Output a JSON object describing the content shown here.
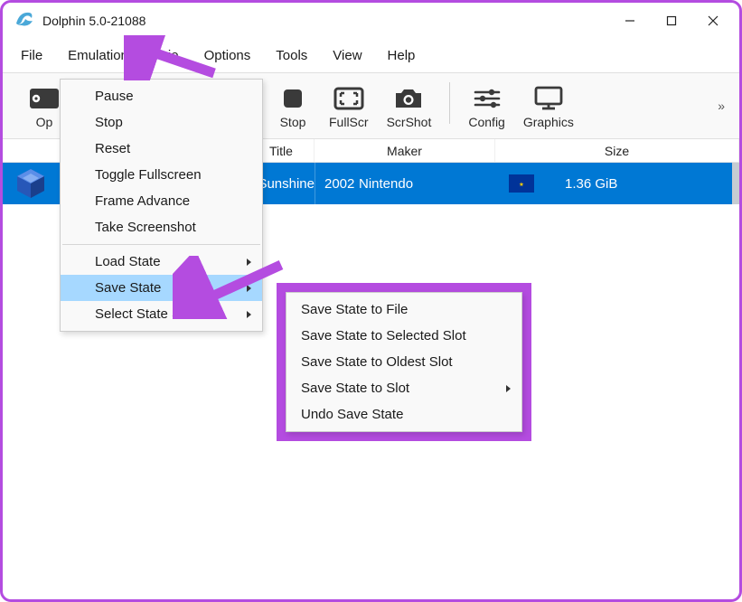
{
  "window": {
    "title": "Dolphin 5.0-21088"
  },
  "menubar": {
    "file": "File",
    "emulation": "Emulation",
    "movie_partial": "ie",
    "options": "Options",
    "tools": "Tools",
    "view": "View",
    "help": "Help"
  },
  "toolbar": {
    "open": "Op",
    "stop": "Stop",
    "fullscr": "FullScr",
    "scrshot": "ScrShot",
    "config": "Config",
    "graphics": "Graphics"
  },
  "columns": {
    "title": "Title",
    "maker": "Maker",
    "size": "Size"
  },
  "game": {
    "title_fragment": "ario Sunshine",
    "year": "2002",
    "maker": "Nintendo",
    "size": "1.36 GiB"
  },
  "emu_menu": {
    "pause": "Pause",
    "stop": "Stop",
    "reset": "Reset",
    "toggle_fullscreen": "Toggle Fullscreen",
    "frame_advance": "Frame Advance",
    "take_screenshot": "Take Screenshot",
    "load_state": "Load State",
    "save_state": "Save State",
    "select_state_slot": "Select State Slot"
  },
  "save_submenu": {
    "to_file": "Save State to File",
    "to_selected": "Save State to Selected Slot",
    "to_oldest": "Save State to Oldest Slot",
    "to_slot": "Save State to Slot",
    "undo": "Undo Save State"
  }
}
